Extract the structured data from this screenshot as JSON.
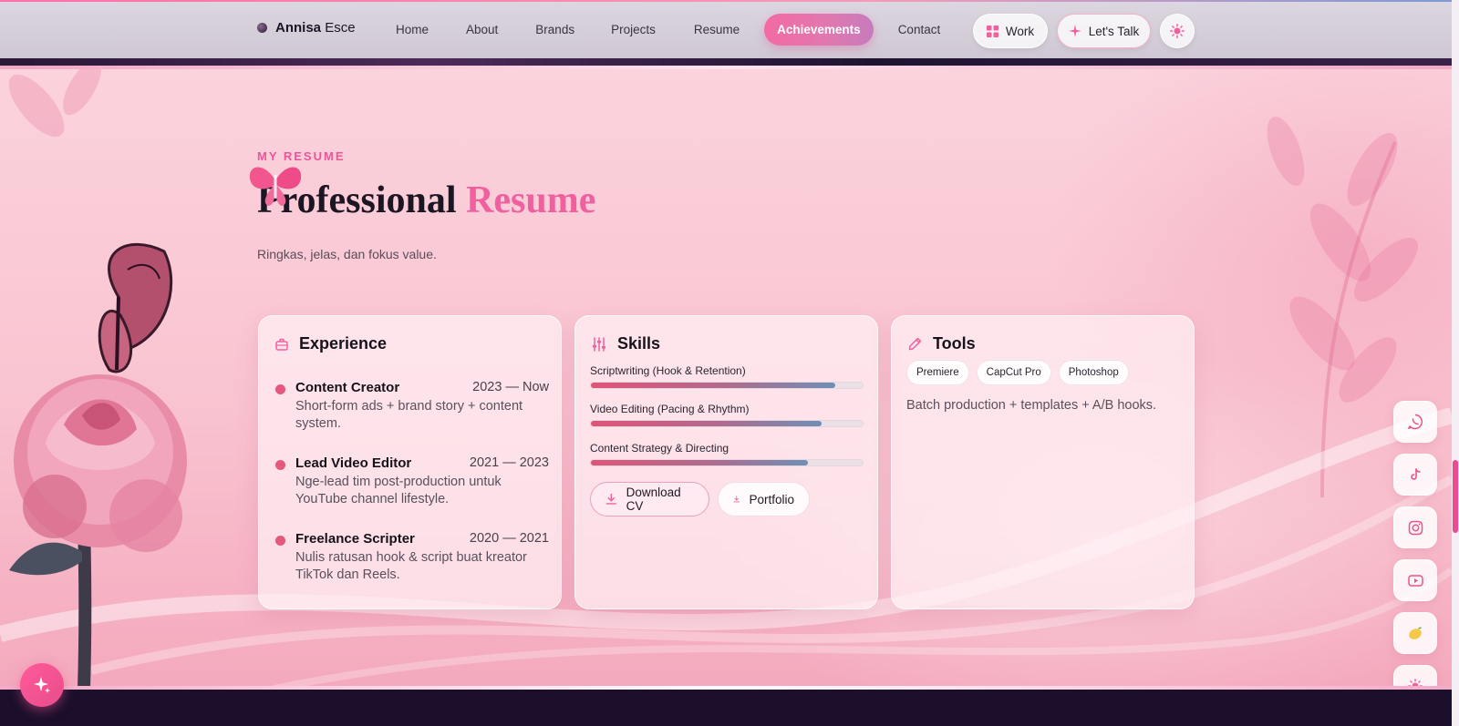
{
  "brand": {
    "first": "Annisa",
    "last": "Esce"
  },
  "nav": {
    "home": "Home",
    "about": "About",
    "brands": "Brands",
    "projects": "Projects",
    "resume": "Resume",
    "achievements": "Achievements",
    "contact": "Contact",
    "work": "Work",
    "talk": "Let's Talk"
  },
  "hero": {
    "eyebrow": "MY RESUME",
    "title_main": "Professional",
    "title_accent": "Resume",
    "subtitle": "Ringkas, jelas, dan fokus value."
  },
  "experience": {
    "title": "Experience",
    "items": [
      {
        "role": "Content Creator",
        "years": "2023 — Now",
        "desc": "Short-form ads + brand story + content system."
      },
      {
        "role": "Lead Video Editor",
        "years": "2021 — 2023",
        "desc": "Nge-lead tim post-production untuk YouTube channel lifestyle."
      },
      {
        "role": "Freelance Scripter",
        "years": "2020 — 2021",
        "desc": "Nulis ratusan hook & script buat kreator TikTok dan Reels."
      }
    ]
  },
  "skills": {
    "title": "Skills",
    "items": [
      {
        "label": "Scriptwriting (Hook & Retention)",
        "level": 0.9
      },
      {
        "label": "Video Editing (Pacing & Rhythm)",
        "level": 0.85
      },
      {
        "label": "Content Strategy & Directing",
        "level": 0.8
      }
    ],
    "download": "Download CV",
    "portfolio": "Portfolio"
  },
  "tools": {
    "title": "Tools",
    "chips": [
      "Premiere",
      "CapCut Pro",
      "Photoshop"
    ],
    "note": "Batch production + templates + A/B hooks."
  },
  "colors": {
    "accent": "#f0609e",
    "accent_deep": "#e4587e",
    "bg_pink": "#f9c3d0"
  }
}
